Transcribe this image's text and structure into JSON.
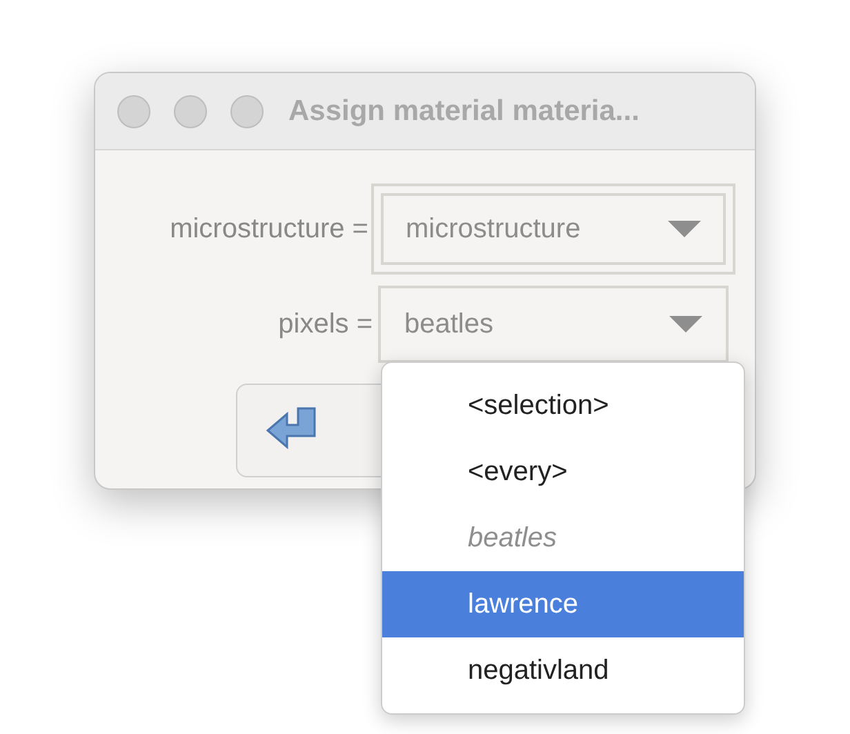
{
  "window": {
    "title": "Assign material materia..."
  },
  "fields": [
    {
      "label": "microstructure =",
      "value": "microstructure",
      "focused": true
    },
    {
      "label": "pixels =",
      "value": "beatles",
      "focused": false
    }
  ],
  "menu": {
    "items": [
      {
        "label": "<selection>",
        "current": false,
        "selected": false
      },
      {
        "label": "<every>",
        "current": false,
        "selected": false
      },
      {
        "label": "beatles",
        "current": true,
        "selected": false
      },
      {
        "label": "lawrence",
        "current": false,
        "selected": true
      },
      {
        "label": "negativland",
        "current": false,
        "selected": false
      }
    ]
  }
}
